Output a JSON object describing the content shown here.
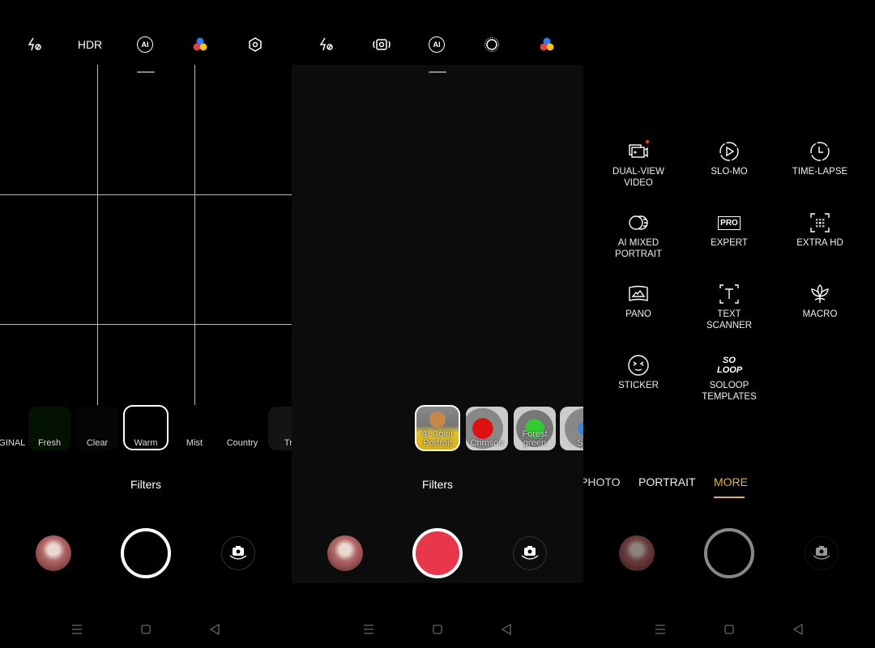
{
  "panel_photo": {
    "top_icons": [
      "flash-off-icon",
      "hdr-icon",
      "ai-icon",
      "color-filter-icon",
      "settings-icon"
    ],
    "hdr_label": "HDR",
    "ai_label": "AI",
    "filters": [
      {
        "label": "ORIGINAL"
      },
      {
        "label": "Fresh"
      },
      {
        "label": "Clear"
      },
      {
        "label": "Warm",
        "selected": true
      },
      {
        "label": "Mist"
      },
      {
        "label": "Country"
      },
      {
        "label": "Travel"
      }
    ],
    "filters_title": "Filters"
  },
  "panel_video": {
    "top_icons": [
      "flash-off-icon",
      "camera-stabilize-icon",
      "ai-icon",
      "brightness-icon",
      "color-filter-icon"
    ],
    "ai_label": "AI",
    "filters": [
      {
        "label": "AI Color Portrait",
        "selected": true
      },
      {
        "label": "Crimson"
      },
      {
        "label": "Forest green"
      },
      {
        "label": "Sky b"
      }
    ],
    "filters_title": "Filters",
    "record_color": "#e8374a"
  },
  "panel_more": {
    "modes": [
      {
        "label": "DUAL-VIEW VIDEO",
        "icon": "dual-view-video-icon",
        "badge": true
      },
      {
        "label": "SLO-MO",
        "icon": "slow-motion-icon"
      },
      {
        "label": "TIME-LAPSE",
        "icon": "time-lapse-icon"
      },
      {
        "label": "AI MIXED PORTRAIT",
        "icon": "ai-mixed-portrait-icon"
      },
      {
        "label": "EXPERT",
        "icon": "pro-icon",
        "icon_text": "PRO"
      },
      {
        "label": "EXTRA HD",
        "icon": "extra-hd-icon"
      },
      {
        "label": "PANO",
        "icon": "panorama-icon"
      },
      {
        "label": "TEXT SCANNER",
        "icon": "text-scanner-icon"
      },
      {
        "label": "MACRO",
        "icon": "macro-icon"
      },
      {
        "label": "STICKER",
        "icon": "sticker-icon"
      },
      {
        "label": "SOLOOP TEMPLATES",
        "icon": "soloop-icon",
        "icon_text": "SO LOOP"
      }
    ],
    "mode_tabs": [
      {
        "label": "PHOTO"
      },
      {
        "label": "PORTRAIT"
      },
      {
        "label": "MORE",
        "active": true
      }
    ],
    "accent_color": "#e6b43c"
  }
}
